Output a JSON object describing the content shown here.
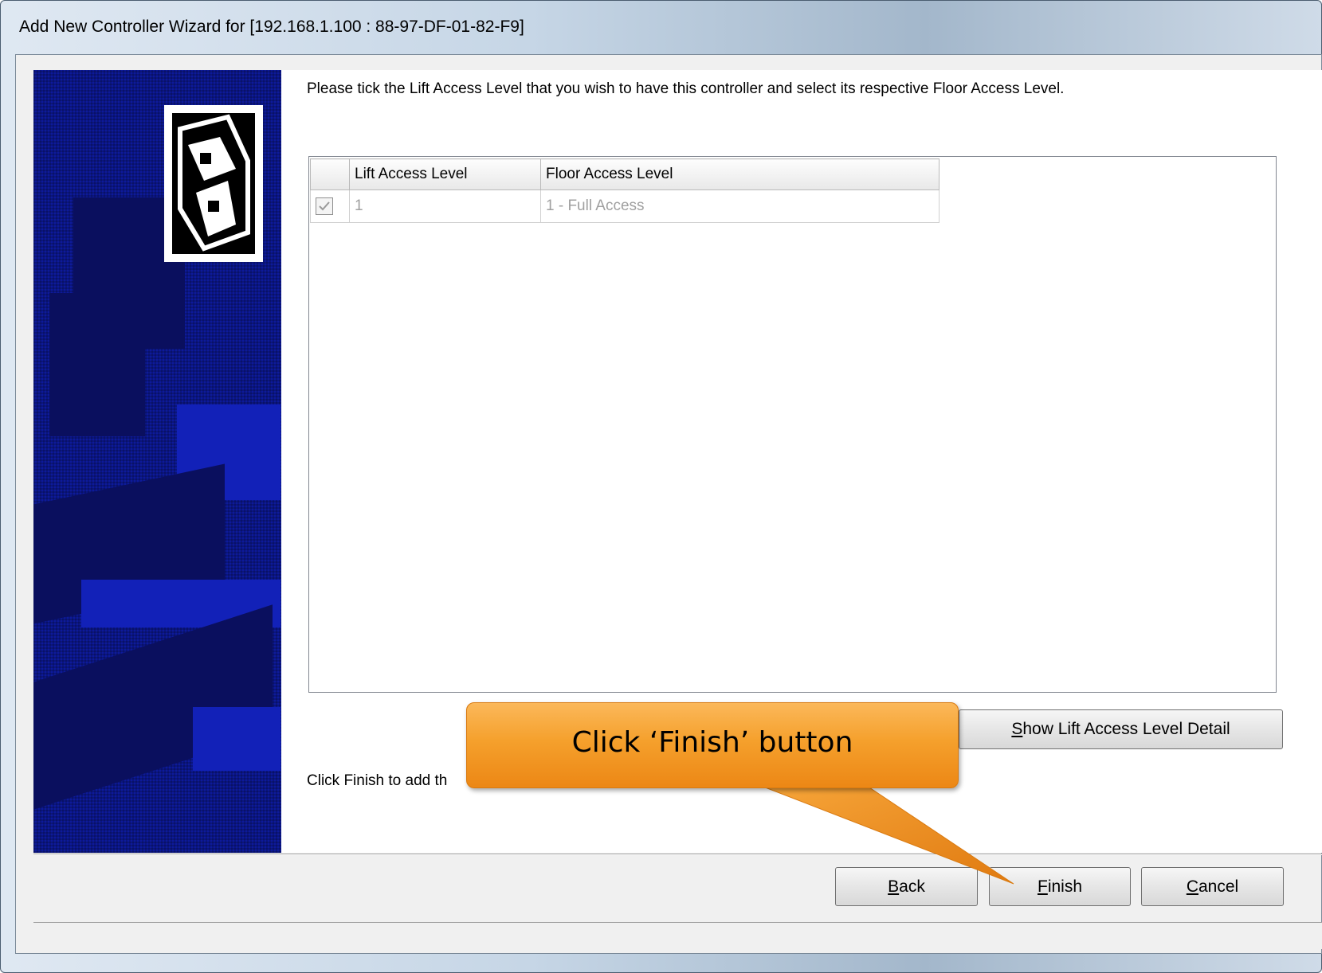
{
  "window": {
    "title": "Add New Controller Wizard for [192.168.1.100 : 88-97-DF-01-82-F9]"
  },
  "instruction": "Please tick the Lift Access Level that you wish to have this controller and select its respective Floor Access Level.",
  "grid": {
    "columns": [
      "",
      "Lift Access Level",
      "Floor Access Level"
    ],
    "rows": [
      {
        "checked": true,
        "lift_access_level": "1",
        "floor_access_level": "1 - Full Access"
      }
    ]
  },
  "buttons": {
    "show_detail": {
      "mnemonic": "S",
      "rest": "how Lift Access Level Detail"
    },
    "back": {
      "mnemonic": "B",
      "rest": "ack"
    },
    "finish": {
      "mnemonic": "F",
      "rest": "inish"
    },
    "cancel": {
      "mnemonic": "C",
      "rest": "ancel"
    }
  },
  "hint_text": "Click Finish to add th",
  "callout": {
    "text": "Click ‘Finish’ button"
  },
  "colors": {
    "sidebar": "#0d1a9a",
    "callout": "#f5a02c"
  }
}
